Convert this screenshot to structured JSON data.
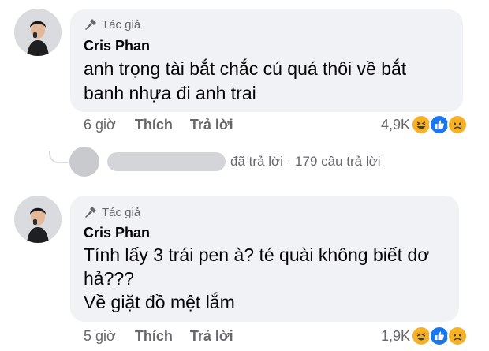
{
  "comments": [
    {
      "author_badge": "Tác giả",
      "author_name": "Cris Phan",
      "text_lines": [
        "anh trọng tài bắt chắc cú quá thôi về bắt",
        "banh nhựa đi anh trai"
      ],
      "time": "6 giờ",
      "like_label": "Thích",
      "reply_label": "Trả lời",
      "reaction_count": "4,9K",
      "reactions": [
        "haha-icon",
        "like-icon",
        "sad-icon"
      ]
    },
    {
      "author_badge": "Tác giả",
      "author_name": "Cris Phan",
      "text_lines": [
        "Tính lấy 3 trái pen à? té quài không biết dơ",
        "hả???",
        "Về giặt đồ mệt lắm"
      ],
      "time": "5 giờ",
      "like_label": "Thích",
      "reply_label": "Trả lời",
      "reaction_count": "1,9K",
      "reactions": [
        "haha-icon",
        "like-icon",
        "sad-icon"
      ]
    }
  ],
  "replies_summary": {
    "replied_label": "đã trả lời",
    "separator": "·",
    "count_label": "179 câu trả lời"
  },
  "colors": {
    "bubble": "#f0f2f5",
    "secondary_text": "#65676b",
    "like_blue": "#1877f2",
    "haha_yellow": "#f7b125"
  }
}
